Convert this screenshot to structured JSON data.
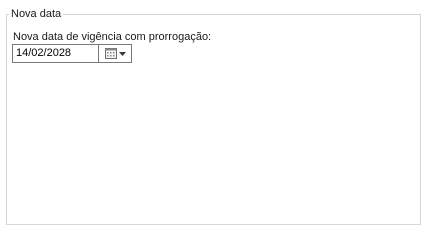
{
  "group": {
    "title": "Nova data"
  },
  "field": {
    "label": "Nova data de vigência com prorrogação:",
    "value": "14/02/2028"
  },
  "icons": {
    "calendar": "calendar-icon",
    "dropdown": "chevron-down-icon"
  }
}
